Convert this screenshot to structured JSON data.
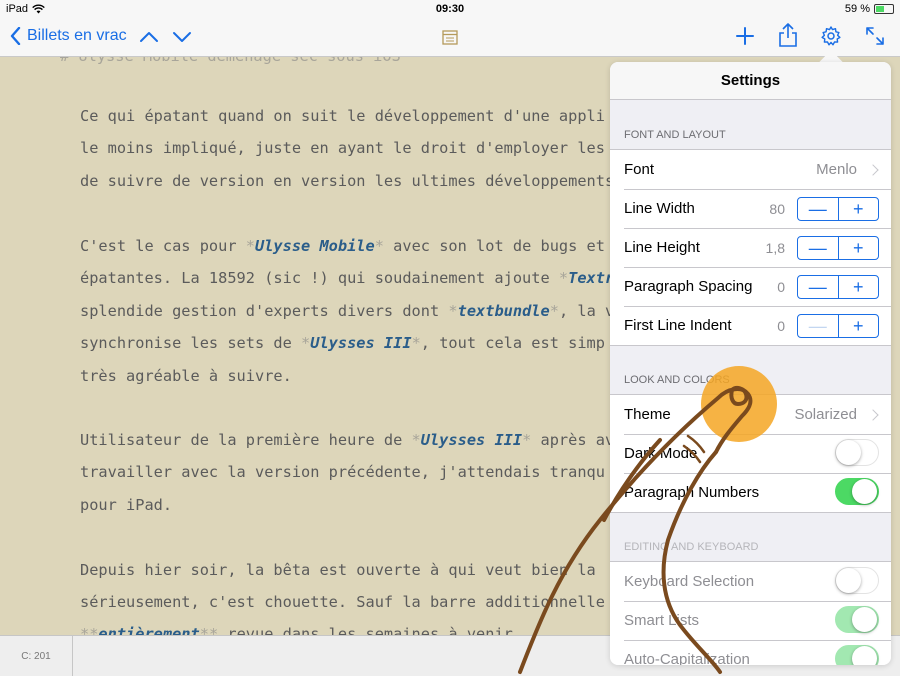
{
  "status": {
    "device": "iPad",
    "time": "09:30",
    "battery": "59 %",
    "battery_level": 0.59
  },
  "nav": {
    "back_label": "Billets en vrac",
    "icons": [
      "chevron-up",
      "chevron-down",
      "preview",
      "add",
      "share",
      "gear",
      "expand"
    ]
  },
  "editor": {
    "lines": [
      {
        "segments": [
          {
            "t": "# Ulysse Mobile déménage sec sous iOS",
            "s": "md"
          }
        ]
      },
      {
        "segments": [
          {
            "t": "Ce qui épatant quand on suit le développement d'une appli"
          }
        ]
      },
      {
        "segments": [
          {
            "t": "le moins impliqué, juste en ayant le droit d'employer les"
          }
        ]
      },
      {
        "segments": [
          {
            "t": "de suivre de version en version les ultimes développements"
          }
        ]
      },
      {
        "segments": [
          {
            "t": "C'est le cas pour "
          },
          {
            "t": "*",
            "s": "md"
          },
          {
            "t": "Ulysse Mobile",
            "s": "em"
          },
          {
            "t": "*",
            "s": "md"
          },
          {
            "t": " avec son lot de bugs et"
          }
        ]
      },
      {
        "segments": [
          {
            "t": "épatantes. La 18592 (sic !) qui soudainement ajoute "
          },
          {
            "t": "*",
            "s": "md"
          },
          {
            "t": "Textr",
            "s": "em"
          }
        ]
      },
      {
        "segments": [
          {
            "t": "splendide gestion d'experts divers dont "
          },
          {
            "t": "*",
            "s": "md"
          },
          {
            "t": "textbundle",
            "s": "em"
          },
          {
            "t": "*",
            "s": "md"
          },
          {
            "t": ", la v"
          }
        ]
      },
      {
        "segments": [
          {
            "t": "synchronise les sets de "
          },
          {
            "t": "*",
            "s": "md"
          },
          {
            "t": "Ulysses III",
            "s": "em"
          },
          {
            "t": "*",
            "s": "md"
          },
          {
            "t": ", tout cela est simp"
          }
        ]
      },
      {
        "segments": [
          {
            "t": "très agréable à suivre."
          }
        ]
      },
      {
        "segments": [
          {
            "t": "Utilisateur de la première heure de "
          },
          {
            "t": "*",
            "s": "md"
          },
          {
            "t": "Ulysses III",
            "s": "em"
          },
          {
            "t": "*",
            "s": "md"
          },
          {
            "t": " après av"
          }
        ]
      },
      {
        "segments": [
          {
            "t": "travailler avec la version précédente, j'attendais tranqu"
          }
        ]
      },
      {
        "segments": [
          {
            "t": "pour iPad."
          }
        ]
      },
      {
        "segments": [
          {
            "t": "Depuis hier soir, la bêta est ouverte à qui veut bien la"
          }
        ]
      },
      {
        "segments": [
          {
            "t": "sérieusement, c'est chouette. Sauf la barre additionnelle"
          }
        ]
      },
      {
        "segments": [
          {
            "t": "**",
            "s": "md"
          },
          {
            "t": "entièrement",
            "s": "em"
          },
          {
            "t": "**",
            "s": "md"
          },
          {
            "t": " revue dans les semaines à venir."
          }
        ]
      }
    ]
  },
  "bottom": {
    "counter": "C: 201"
  },
  "settings": {
    "title": "Settings",
    "font_layout": {
      "header": "FONT AND LAYOUT",
      "font_label": "Font",
      "font_value": "Menlo",
      "line_width_label": "Line Width",
      "line_width_value": "80",
      "line_height_label": "Line Height",
      "line_height_value": "1,8",
      "paragraph_spacing_label": "Paragraph Spacing",
      "paragraph_spacing_value": "0",
      "first_line_indent_label": "First Line Indent",
      "first_line_indent_value": "0",
      "minus": "—",
      "plus": "+"
    },
    "look_colors": {
      "header": "LOOK AND COLORS",
      "theme_label": "Theme",
      "theme_value": "Solarized",
      "dark_mode_label": "Dark Mode",
      "dark_mode_on": false,
      "paragraph_numbers_label": "Paragraph Numbers",
      "paragraph_numbers_on": true
    },
    "editing_keyboard": {
      "header": "EDITING AND KEYBOARD",
      "keyboard_selection_label": "Keyboard Selection",
      "keyboard_selection_on": false,
      "smart_lists_label": "Smart Lists",
      "smart_lists_on": true,
      "auto_cap_label": "Auto-Capitalization",
      "auto_cap_on": true
    }
  },
  "colors": {
    "accent": "#1a6ee5",
    "editor_bg": "#ddd6ba",
    "emphasis": "#2a5d8a",
    "toggle_on": "#4cd964",
    "touch_highlight": "#f5a623",
    "hand_outline": "#7a4a1e"
  }
}
